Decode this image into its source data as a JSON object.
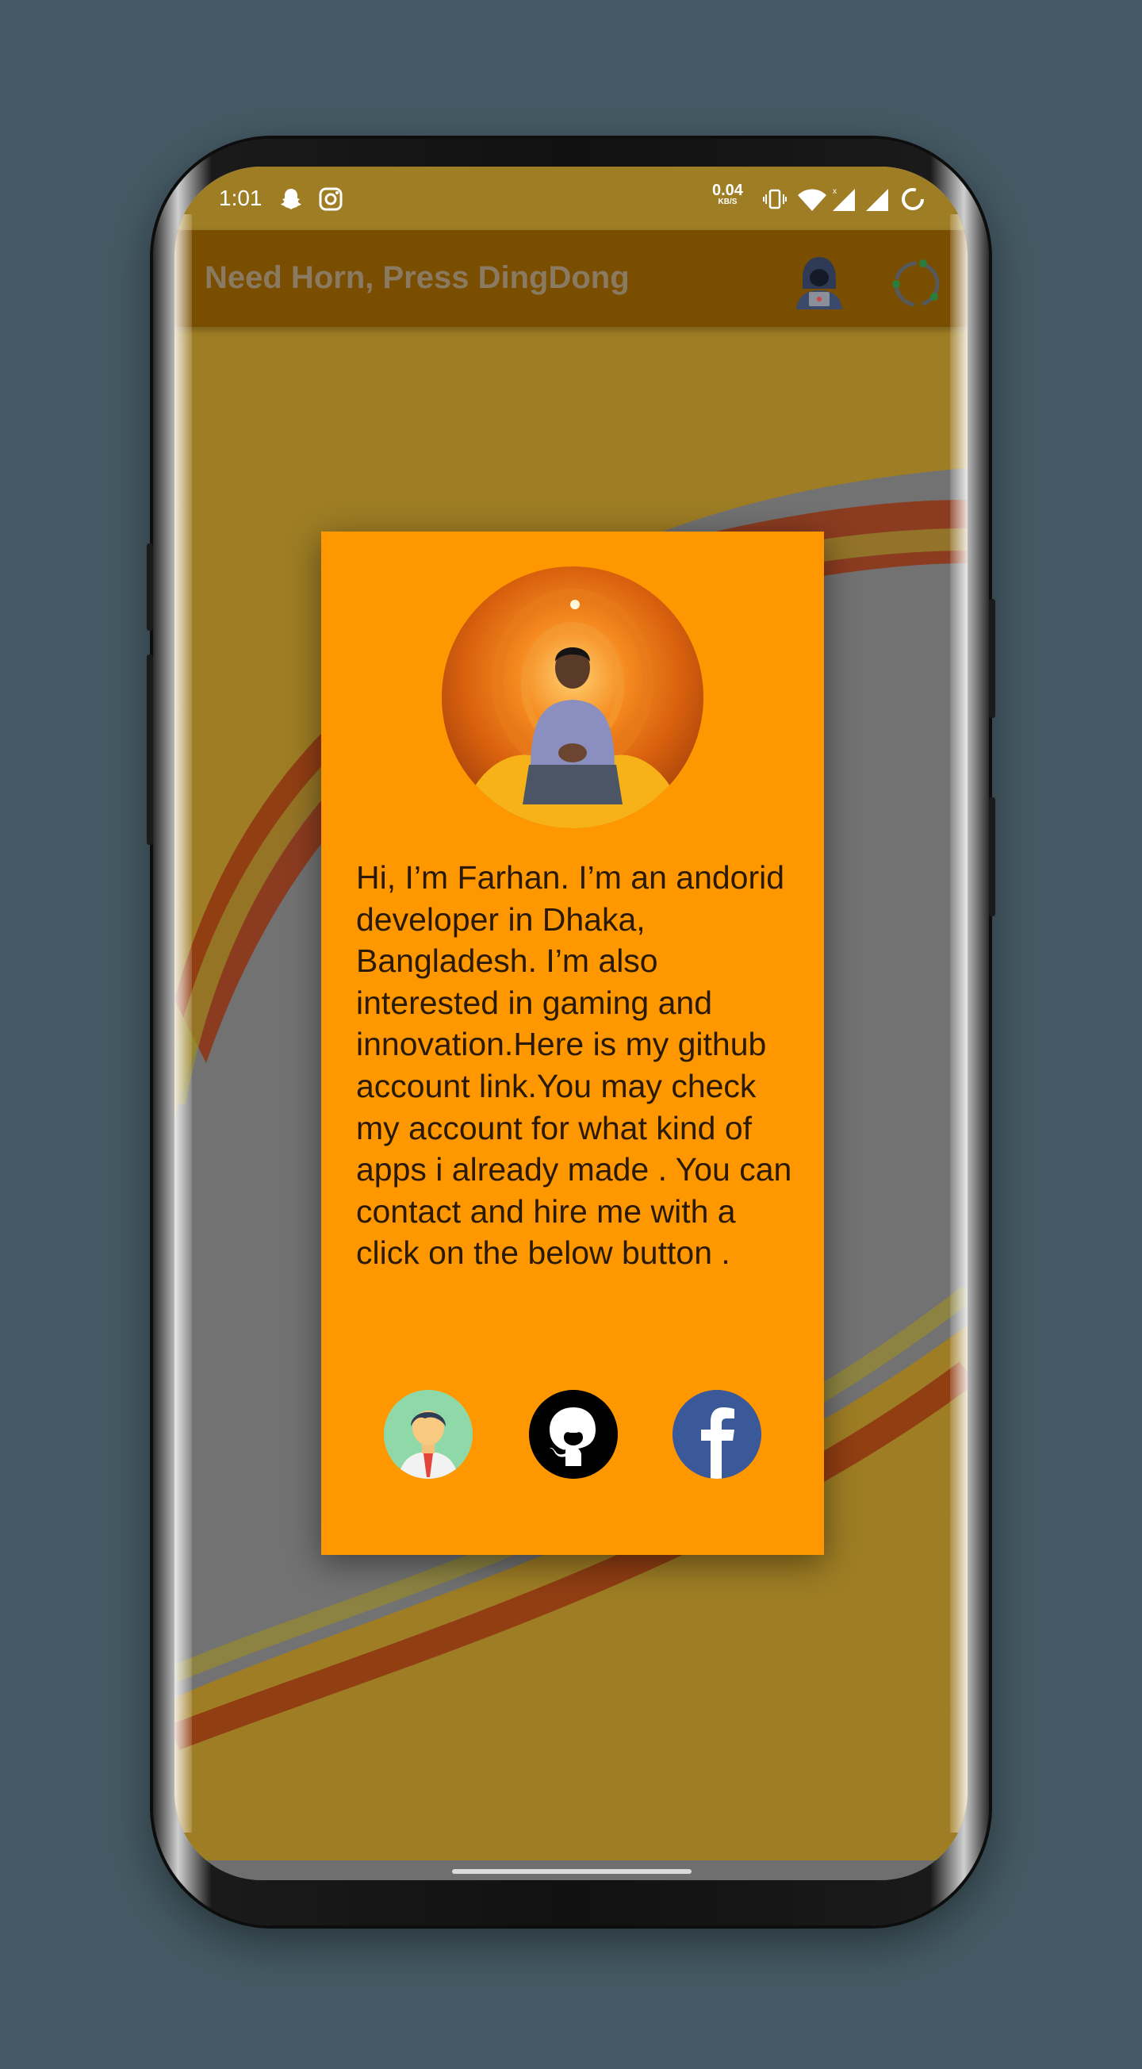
{
  "status_bar": {
    "time": "1:01",
    "net_speed_value": "0.04",
    "net_speed_unit": "KB/S",
    "icons": [
      "snapchat-icon",
      "instagram-icon",
      "vibrate-icon",
      "wifi-icon",
      "signal-icon",
      "signal-icon",
      "battery-icon"
    ]
  },
  "app_bar": {
    "title": "Need Horn, Press DingDong",
    "icons": [
      "hacker-avatar-icon",
      "loading-spinner-icon"
    ]
  },
  "dialog": {
    "bio": "Hi, I’m Farhan. I’m an andorid developer in Dhaka, Bangladesh. I’m also interested in gaming and innovation.Here is my github account link.You may check my account for what kind of apps i already made . You can contact and hire me with a click on the below button .",
    "buttons": [
      "contact-person-icon",
      "github-icon",
      "facebook-icon"
    ]
  },
  "colors": {
    "background": "#455a64",
    "dialog": "#ff9800",
    "app_bar": "#7a4e00",
    "bio_text": "#2a1a05",
    "facebook": "#3b5998"
  }
}
